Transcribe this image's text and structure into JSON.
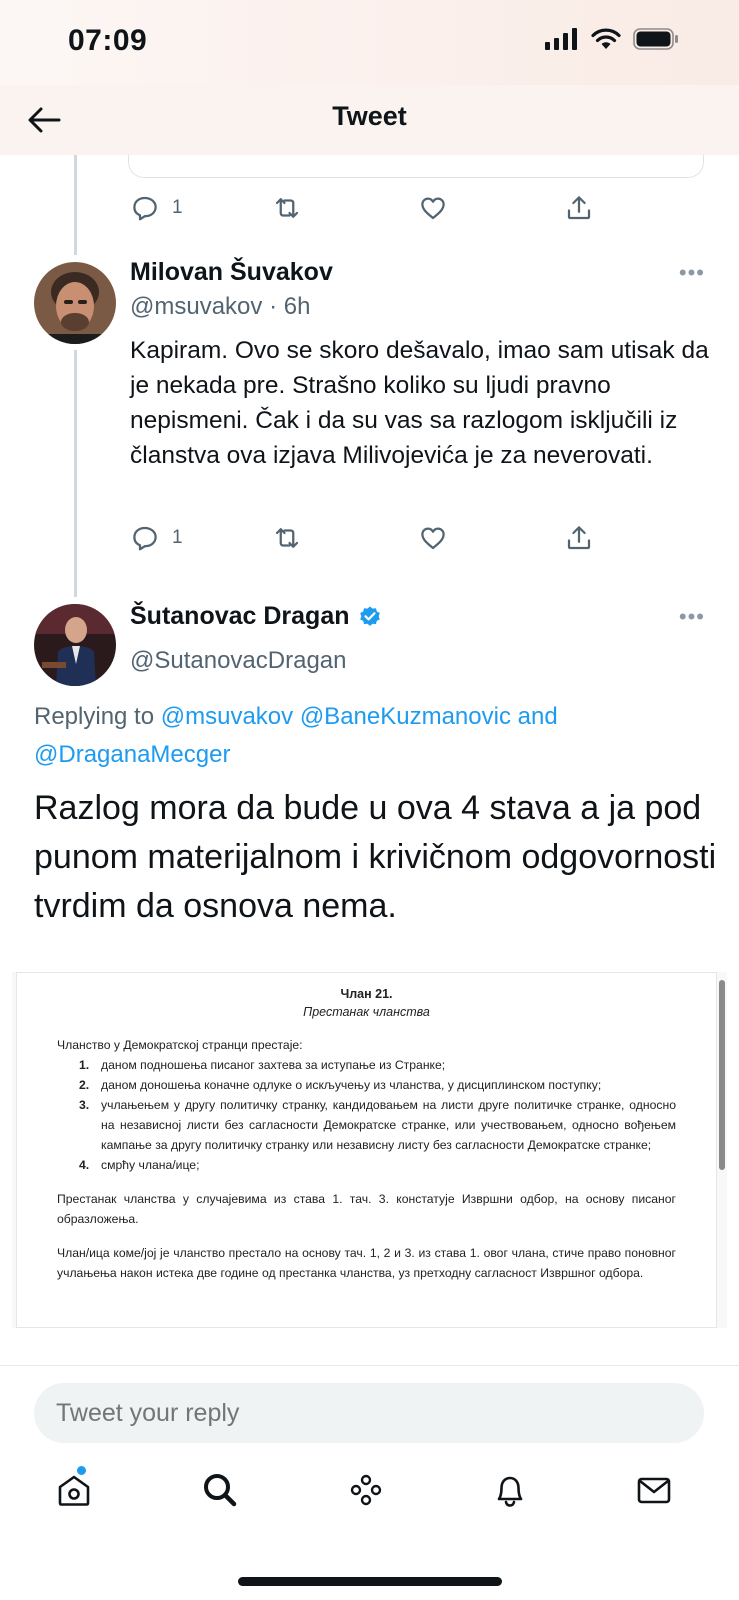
{
  "status_bar": {
    "time": "07:09"
  },
  "header": {
    "title": "Tweet"
  },
  "prev_tweet": {
    "reply_count": "1"
  },
  "reply_tweet": {
    "name": "Milovan Šuvakov",
    "handle_time": "@msuvakov · 6h",
    "text": "Kapiram. Ovo se skoro dešavalo, imao sam utisak da je nekada pre. Strašno koliko su ljudi pravno nepismeni. Čak i da su vas sa razlogom isključili iz članstva ova izjava Milivojevića je za neverovati.",
    "reply_count": "1"
  },
  "main_tweet": {
    "name": "Šutanovac Dragan",
    "handle": "@SutanovacDragan",
    "replying_prefix": "Replying to",
    "replying_users": "@msuvakov @BaneKuzmanovic",
    "replying_and": "and",
    "replying_last": "@DraganaMecger",
    "text": "Razlog mora da bude u ova 4 stava a ja pod punom materijalnom i krivičnom odgovornosti tvrdim da osnova nema.",
    "verified_color": "#1d9bf0"
  },
  "document": {
    "heading": "Члан 21.",
    "subheading": "Престанак чланства",
    "intro": "Чланство у Демократској странци престаје:",
    "items": [
      {
        "num": "1.",
        "text": "даном подношења писаног захтева за иступање из Странке;"
      },
      {
        "num": "2.",
        "text": "даном доношења коначне одлуке о искључењу из чланства, у дисциплинском поступку;"
      },
      {
        "num": "3.",
        "text": "учлањењем у другу политичку странку, кандидовањем на листи друге политичке странке, односно на независној листи без сагласности Демократске странке, или учествовањем, односно вођењем кампање за другу политичку странку или независну листу без сагласности Демократске странке;"
      },
      {
        "num": "4.",
        "text": "смрћу члана/ице;"
      }
    ],
    "para1": "Престанак чланства у случајевима из става 1. тач. 3. констатује Извршни одбор, на основу писаног образложења.",
    "para2": "Члан/ица коме/јој је чланство престало на основу тач. 1, 2 и 3. из става 1. овог члана, стиче право поновног учлањења након истека две године од престанка чланства, уз претходну сагласност Извршног одбора."
  },
  "reply_box": {
    "placeholder": "Tweet your reply"
  },
  "tabs": [
    "home-icon",
    "search-icon",
    "spaces-icon",
    "notifications-icon",
    "messages-icon"
  ],
  "colors": {
    "accent": "#1d9bf0",
    "text": "#0f1419",
    "secondary": "#536471"
  }
}
